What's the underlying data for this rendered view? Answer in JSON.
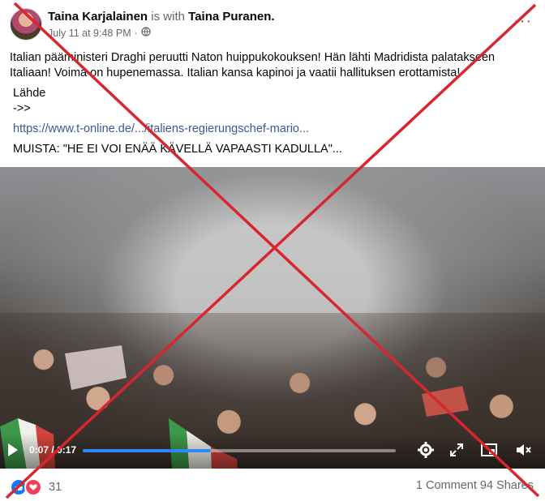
{
  "header": {
    "author": "Taina Karjalainen",
    "with_text": "is with",
    "tagged": "Taina Puranen.",
    "timestamp": "July 11 at 9:48 PM",
    "separator": "·",
    "more_label": "···"
  },
  "post": {
    "text": "Italian pääministeri Draghi peruutti Naton huippukokouksen!  Hän lähti Madridista palatakseen Italiaan! Voima on hupenemassa.  Italian kansa kapinoi ja vaatii hallituksen erottamista!",
    "source_label": "Lähde",
    "arrow": "->>",
    "link": "https://www.t-online.de/.../italiens-regierungschef-mario...",
    "muista": "MUISTA: \"HE EI VOI ENÄÄ KÄVELLÄ VAPAASTI KADULLA\"..."
  },
  "video": {
    "current_time": "0:07",
    "time_separator": "/",
    "duration": "0:17",
    "progress": 0.41
  },
  "footer": {
    "reaction_count": "31",
    "comments": "1 Comment",
    "shares": "94 Shares"
  },
  "colors": {
    "link": "#385898",
    "like": "#1877f2",
    "love": "#f33e58",
    "overlay_x": "#d9262e",
    "progress": "#2d88ff"
  },
  "icons": [
    "globe-icon",
    "more-icon",
    "play-icon",
    "settings-icon",
    "fullscreen-icon",
    "miniplayer-icon",
    "volume-muted-icon",
    "like-icon",
    "love-icon"
  ]
}
